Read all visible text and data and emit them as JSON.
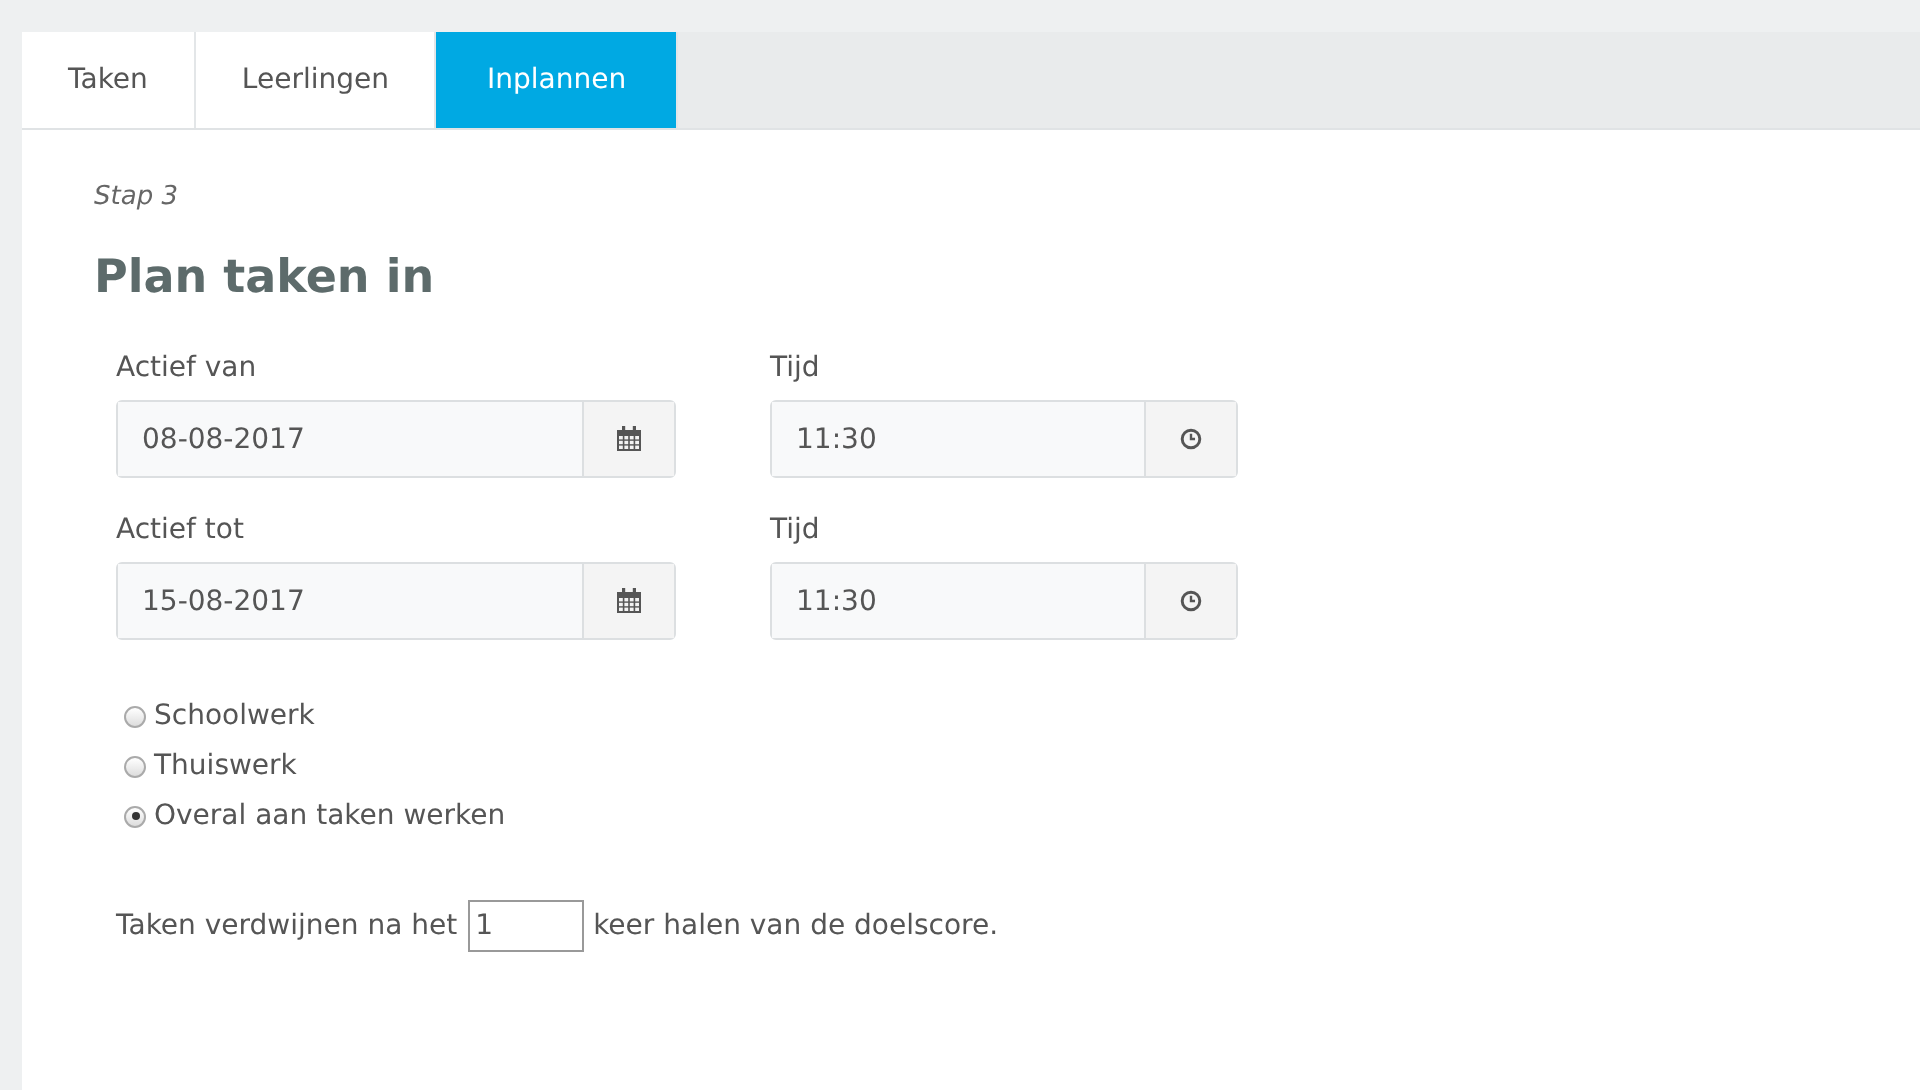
{
  "tabs": [
    {
      "label": "Taken",
      "selected": false
    },
    {
      "label": "Leerlingen",
      "selected": false
    },
    {
      "label": "Inplannen",
      "selected": true
    }
  ],
  "step": "Stap 3",
  "heading": "Plan taken in",
  "date_rows": [
    {
      "date_label": "Actief van",
      "date_value": "08-08-2017",
      "time_label": "Tijd",
      "time_value": "11:30"
    },
    {
      "date_label": "Actief tot",
      "date_value": "15-08-2017",
      "time_label": "Tijd",
      "time_value": "11:30"
    }
  ],
  "options": [
    {
      "label": "Schoolwerk",
      "selected": false
    },
    {
      "label": "Thuiswerk",
      "selected": false
    },
    {
      "label": "Overal aan taken werken",
      "selected": true
    }
  ],
  "sentence": {
    "before": "Taken verdwijnen na het",
    "value": "1",
    "after": "keer halen van de doelscore."
  }
}
